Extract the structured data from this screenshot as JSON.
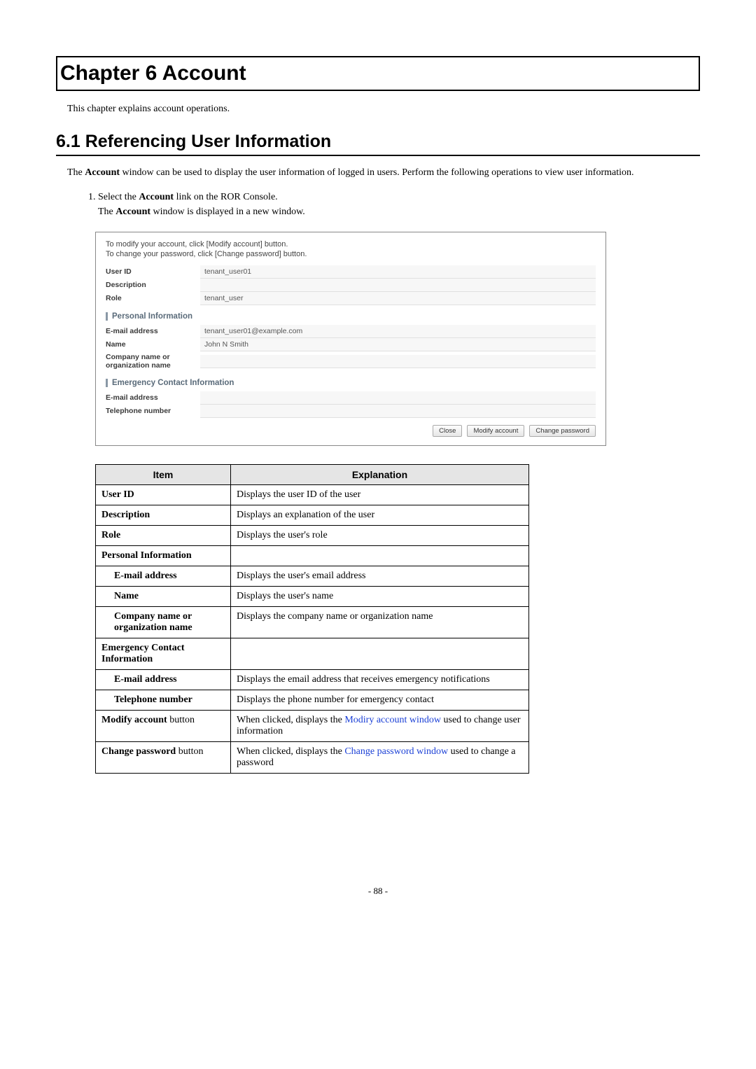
{
  "chapter": {
    "title": "Chapter 6 Account"
  },
  "intro": "This chapter explains account operations.",
  "section": {
    "title": "6.1  Referencing User Information"
  },
  "body": {
    "p1a": "The ",
    "p1b": "Account",
    "p1c": " window can be used to display the user information of logged in users. Perform the following operations to view user information."
  },
  "step": {
    "s1a": "Select the ",
    "s1b": "Account",
    "s1c": " link on the ROR Console.",
    "s2a": "The ",
    "s2b": "Account",
    "s2c": " window is displayed in a new window."
  },
  "ss": {
    "instr1": "To modify your account, click [Modify account] button.",
    "instr2": "To change your password, click [Change password] button.",
    "labels": {
      "userId": "User ID",
      "description": "Description",
      "role": "Role",
      "personal": "Personal Information",
      "email": "E-mail address",
      "name": "Name",
      "company": "Company name or organization name",
      "emergency": "Emergency Contact Information",
      "eEmail": "E-mail address",
      "tel": "Telephone number"
    },
    "values": {
      "userId": "tenant_user01",
      "description": "",
      "role": "tenant_user",
      "email": "tenant_user01@example.com",
      "name": "John  N  Smith",
      "company": "",
      "eEmail": "",
      "tel": ""
    },
    "buttons": {
      "close": "Close",
      "modify": "Modify account",
      "change": "Change password"
    }
  },
  "table": {
    "headers": {
      "item": "Item",
      "explanation": "Explanation"
    },
    "rows": [
      {
        "item_b": "User ID",
        "item_n": "",
        "exp": "Displays the user ID of the user",
        "indent": false
      },
      {
        "item_b": "Description",
        "item_n": "",
        "exp": "Displays an explanation of the user",
        "indent": false
      },
      {
        "item_b": "Role",
        "item_n": "",
        "exp": "Displays the user's role",
        "indent": false
      },
      {
        "item_b": "Personal Information",
        "item_n": "",
        "exp": "",
        "indent": false
      },
      {
        "item_b": "E-mail address",
        "item_n": "",
        "exp": "Displays the user's email address",
        "indent": true
      },
      {
        "item_b": "Name",
        "item_n": "",
        "exp": "Displays the user's name",
        "indent": true
      },
      {
        "item_b": "Company name or organization name",
        "item_n": "",
        "exp": "Displays the company name or organization name",
        "indent": true
      },
      {
        "item_b": "Emergency Contact Information",
        "item_n": "",
        "exp": "",
        "indent": false
      },
      {
        "item_b": "E-mail address",
        "item_n": "",
        "exp": "Displays the email address that receives emergency notifications",
        "indent": true
      },
      {
        "item_b": "Telephone number",
        "item_n": "",
        "exp": "Displays the phone number for emergency contact",
        "indent": true
      },
      {
        "item_b": "Modify account",
        "item_n": " button",
        "exp_pre": "When clicked, displays the ",
        "exp_link": "Modiry account window",
        "exp_post": " used to change user information",
        "indent": false
      },
      {
        "item_b": "Change password",
        "item_n": " button",
        "exp_pre": "When clicked, displays the ",
        "exp_link": "Change password window",
        "exp_post": " used to change a password",
        "indent": false
      }
    ]
  },
  "pageNumber": "- 88 -"
}
